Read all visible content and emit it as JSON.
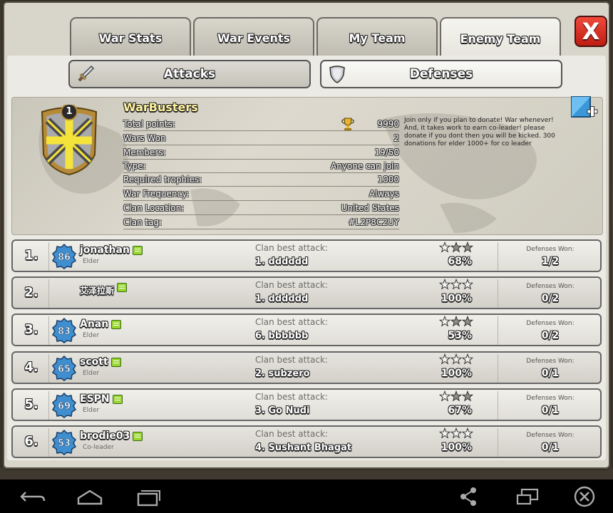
{
  "tabs": [
    "War Stats",
    "War Events",
    "My Team",
    "Enemy Team"
  ],
  "active_tab": "Enemy Team",
  "close_label": "X",
  "subtabs": {
    "attacks": "Attacks",
    "defenses": "Defenses"
  },
  "active_subtab": "Defenses",
  "clan": {
    "badge_level": "1",
    "name": "WarBusters",
    "stats": [
      {
        "key": "Total points:",
        "value": "9990"
      },
      {
        "key": "Wars Won",
        "value": "2"
      },
      {
        "key": "Members:",
        "value": "19/50"
      },
      {
        "key": "Type:",
        "value": "Anyone can join"
      },
      {
        "key": "Required trophies:",
        "value": "1000"
      },
      {
        "key": "War Frequency:",
        "value": "Always"
      },
      {
        "key": "Clan Location:",
        "value": "United States"
      },
      {
        "key": "Clan tag:",
        "value": "#L2P8C2UY"
      }
    ],
    "description": "Join only if you plan to donate! War whenever! And, it takes work to earn co-leader! please donate if you dont then you will be kicked. 300 donations for elder 1000+ for co leader"
  },
  "labels": {
    "clan_best_attack": "Clan best attack:",
    "defenses_won": "Defenses Won:"
  },
  "members": [
    {
      "rank": "1.",
      "level": "86",
      "name": "jonathan",
      "role": "Elder",
      "attack": "1. dddddd",
      "stars": 2,
      "percent": "68%",
      "defenses": "1/2"
    },
    {
      "rank": "2.",
      "level": "",
      "name": "艾泽拉斯",
      "role": "",
      "attack": "1. dddddd",
      "stars": 3,
      "percent": "100%",
      "defenses": "0/2"
    },
    {
      "rank": "3.",
      "level": "83",
      "name": "Anan",
      "role": "Elder",
      "attack": "6. bbbbbb",
      "stars": 2,
      "percent": "53%",
      "defenses": "0/2"
    },
    {
      "rank": "4.",
      "level": "65",
      "name": "scott",
      "role": "Elder",
      "attack": "2. subzero",
      "stars": 3,
      "percent": "100%",
      "defenses": "0/1"
    },
    {
      "rank": "5.",
      "level": "69",
      "name": "ESPN",
      "role": "Elder",
      "attack": "3. Go Nudi",
      "stars": 2,
      "percent": "67%",
      "defenses": "0/1"
    },
    {
      "rank": "6.",
      "level": "53",
      "name": "brodie03",
      "role": "Co-leader",
      "attack": "4. Sushant Bhagat",
      "stars": 3,
      "percent": "100%",
      "defenses": "0/1"
    }
  ],
  "colors": {
    "close": "#d8281b",
    "star_gold": "#f3c21f",
    "star_gray": "#8f8d87",
    "level_badge": "#3f8fd0",
    "chat_icon": "#9ad630"
  },
  "navbar_icons": [
    "back-icon",
    "home-icon",
    "recent-apps-icon",
    "share-icon",
    "screen-mirror-icon",
    "close-circle-icon"
  ]
}
